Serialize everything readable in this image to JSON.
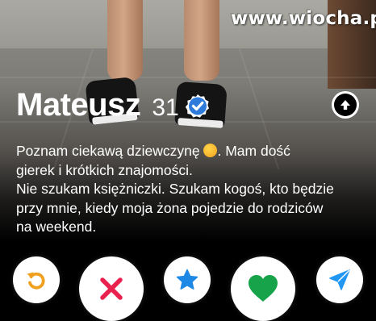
{
  "watermark": {
    "text": "www.wiocha.pl"
  },
  "profile": {
    "name": "Mateusz",
    "age": "31",
    "verified": true,
    "verified_icon": "verified-badge-icon",
    "bio_lines": [
      "Poznam ciekawą dziewczynę",
      ". Mam dość",
      "gierek i krótkich znajomości.",
      "Nie szukam księżniczki. Szukam kogoś, kto będzie",
      "przy mnie, kiedy moja żona pojedzie do rodziców",
      "na weekend."
    ],
    "bio_emoji": "hugging-face-emoji"
  },
  "actions": [
    {
      "name": "rewind-button",
      "icon": "rewind-icon",
      "color": "#f0a020"
    },
    {
      "name": "nope-button",
      "icon": "x-icon",
      "color": "#e8214f"
    },
    {
      "name": "super-like-button",
      "icon": "star-icon",
      "color": "#1e88e5"
    },
    {
      "name": "like-button",
      "icon": "heart-icon",
      "color": "#17a349"
    },
    {
      "name": "boost-button",
      "icon": "send-icon",
      "color": "#2196f3"
    }
  ],
  "colors": {
    "background": "#000000",
    "text": "#ffffff",
    "verified": "#2e7bdc"
  }
}
